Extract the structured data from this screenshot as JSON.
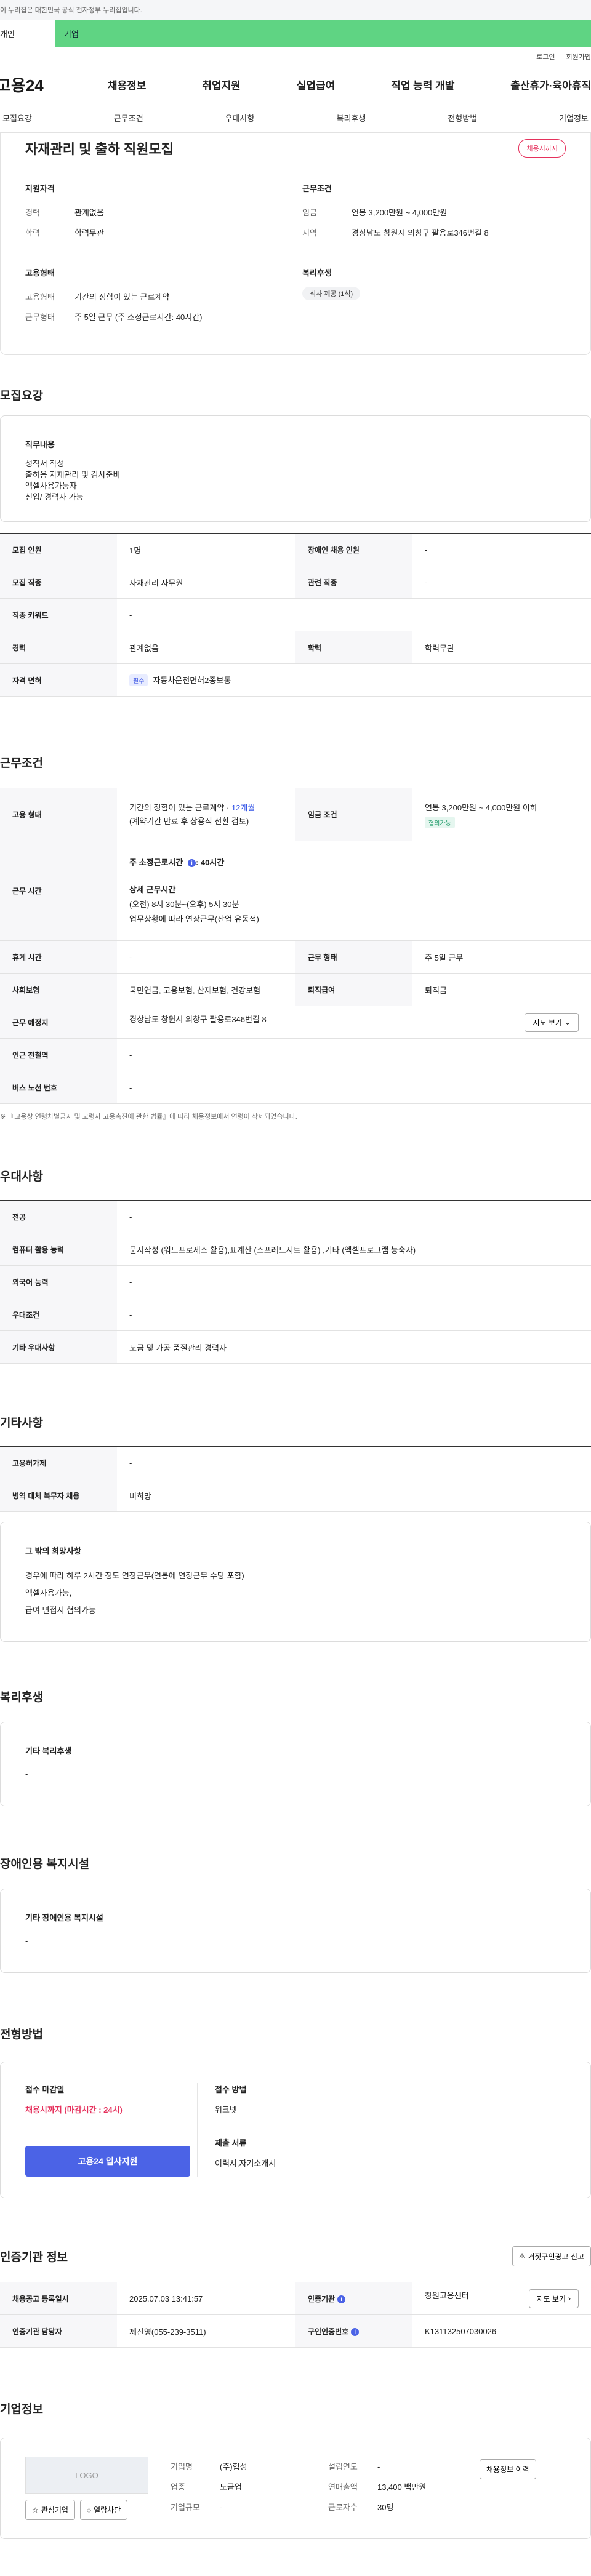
{
  "top_notice": "이 누리집은 대한민국 공식 전자정부 누리집입니다.",
  "tabs": [
    "개인",
    "기업"
  ],
  "util": {
    "login": "로그인",
    "join": "회원가입"
  },
  "logo": "고용24",
  "gnb": [
    "채용정보",
    "취업지원",
    "실업급여",
    "직업 능력 개발",
    "출산휴가·육아휴직"
  ],
  "anchors": [
    "모집요강",
    "근무조건",
    "우대사항",
    "복리후생",
    "전형방법",
    "기업정보"
  ],
  "summary": {
    "title": "자재관리 및 출하 직원모집",
    "status": "채용시까지",
    "qual_h": "지원자격",
    "career_k": "경력",
    "career_v": "관계없음",
    "edu_k": "학력",
    "edu_v": "학력무관",
    "work_h": "근무조건",
    "wage_k": "임금",
    "wage_v": "연봉 3,200만원 ~ 4,000만원",
    "area_k": "지역",
    "area_v": "경상남도 창원시 의창구 팔용로346번길 8",
    "emp_h": "고용형태",
    "emptype_k": "고용형태",
    "emptype_v": "기간의 정함이 있는 근로계약",
    "worktime_k": "근무형태",
    "worktime_v": "주 5일 근무 (주 소정근로시간: 40시간)",
    "welfare_h": "복리후생",
    "welfare_chip": "식사 제공 (1식)"
  },
  "recruit": {
    "title": "모집요강",
    "duty_h": "직무내용",
    "duty": [
      "성적서 작성",
      "출하용 자재관리 및 검사준비",
      "엑셀사용가능자",
      "신입/ 경력자 가능"
    ],
    "rows": {
      "num_k": "모집 인원",
      "num_v": "1명",
      "dis_k": "장애인 채용 인원",
      "dis_v": "-",
      "job_k": "모집 직종",
      "job_v": "자재관리 사무원",
      "rel_k": "관련 직종",
      "rel_v": "-",
      "kw_k": "직종 키워드",
      "kw_v": "-",
      "car_k": "경력",
      "car_v": "관계없음",
      "edu_k": "학력",
      "edu_v": "학력무관",
      "lic_k": "자격 면허",
      "lic_tag": "필수",
      "lic_v": "자동차운전면허2종보통"
    }
  },
  "work": {
    "title": "근무조건",
    "emp_k": "고용 형태",
    "emp_v1": "기간의 정함이 있는 근로계약 · ",
    "emp_months": "12개월",
    "emp_v2": "(계약기간 만료 후 상용직 전환 검토)",
    "wage_k": "임금 조건",
    "wage_v": "연봉 3,200만원 ~ 4,000만원 이하",
    "wage_tag": "협의가능",
    "time_k": "근무 시간",
    "time_v1": "주 소정근로시간",
    "time_v2": ": 40시간",
    "time_detail_h": "상세 근무시간",
    "time_detail1": "(오전) 8시 30분~(오후) 5시 30분",
    "time_detail2": "업무상황에 따라 연장근무(잔업 유동적)",
    "rest_k": "휴게 시간",
    "rest_v": "-",
    "form_k": "근무 형태",
    "form_v": "주 5일 근무",
    "ins_k": "사회보험",
    "ins_v": "국민연금, 고용보험, 산재보험, 건강보험",
    "ret_k": "퇴직급여",
    "ret_v": "퇴직금",
    "place_k": "근무 예정지",
    "place_v": "경상남도 창원시 의창구 팔용로346번길 8",
    "map_btn": "지도 보기",
    "sub_k": "인근 전철역",
    "sub_v": "-",
    "bus_k": "버스 노선 번호",
    "bus_v": "-",
    "note": "※ 『고용상 연령차별금지 및 고령자 고용촉진에 관한 법률』에 따라 채용정보에서 연령이 삭제되었습니다."
  },
  "pref": {
    "title": "우대사항",
    "major_k": "전공",
    "major_v": "-",
    "pc_k": "컴퓨터 활용 능력",
    "pc_v": "문서작성 (워드프로세스 활용),표계산 (스프레드시트 활용) ,기타 (엑셀프로그램 능숙자)",
    "lang_k": "외국어 능력",
    "lang_v": "-",
    "cond_k": "우대조건",
    "cond_v": "-",
    "etc_k": "기타 우대사항",
    "etc_v": "도금 및 가공 품질관리 경력자"
  },
  "other": {
    "title": "기타사항",
    "permit_k": "고용허가제",
    "permit_v": "-",
    "mil_k": "병역 대체 복무자 채용",
    "mil_v": "비희망",
    "wish_h": "그 밖의 희망사항",
    "wish": [
      "경우에 따라 하루 2시간 정도 연장근무(연봉에 연장근무 수당 포함)",
      "엑셀사용가능,",
      "급여 면접시 협의가능"
    ]
  },
  "welfare": {
    "title": "복리후생",
    "h": "기타 복리후생",
    "v": "-"
  },
  "disab": {
    "title": "장애인용 복지시설",
    "h": "기타 장애인용 복지시설",
    "v": "-"
  },
  "process": {
    "title": "전형방법",
    "deadline_h": "접수 마감일",
    "deadline_v": "채용시까지 (마감시간 : 24시)",
    "apply_btn": "고용24 입사지원",
    "method_h": "접수 방법",
    "method_v": "워크넷",
    "docs_h": "제출 서류",
    "docs_v": "이력서,자기소개서"
  },
  "cert": {
    "title": "인증기관 정보",
    "report_btn": "거짓구인광고 신고",
    "reg_k": "채용공고 등록일시",
    "reg_v": "2025.07.03 13:41:57",
    "org_k": "인증기관",
    "org_v": "창원고용센터",
    "map_btn": "지도 보기",
    "mgr_k": "인증기관 담당자",
    "mgr_v": "제진영(055-239-3511)",
    "num_k": "구인인증번호",
    "num_v": "K131132507030026"
  },
  "company": {
    "title": "기업정보",
    "logo_text": "LOGO",
    "fav_btn": "관심기업",
    "block_btn": "열람차단",
    "name_k": "기업명",
    "name_v": "(주)협성",
    "ind_k": "업종",
    "ind_v": "도금업",
    "size_k": "기업규모",
    "size_v": "-",
    "year_k": "설립연도",
    "year_v": "-",
    "sales_k": "연매출액",
    "sales_v": "13,400 백만원",
    "emp_k": "근로자수",
    "emp_v": "30명",
    "history_btn": "채용정보 이력"
  }
}
